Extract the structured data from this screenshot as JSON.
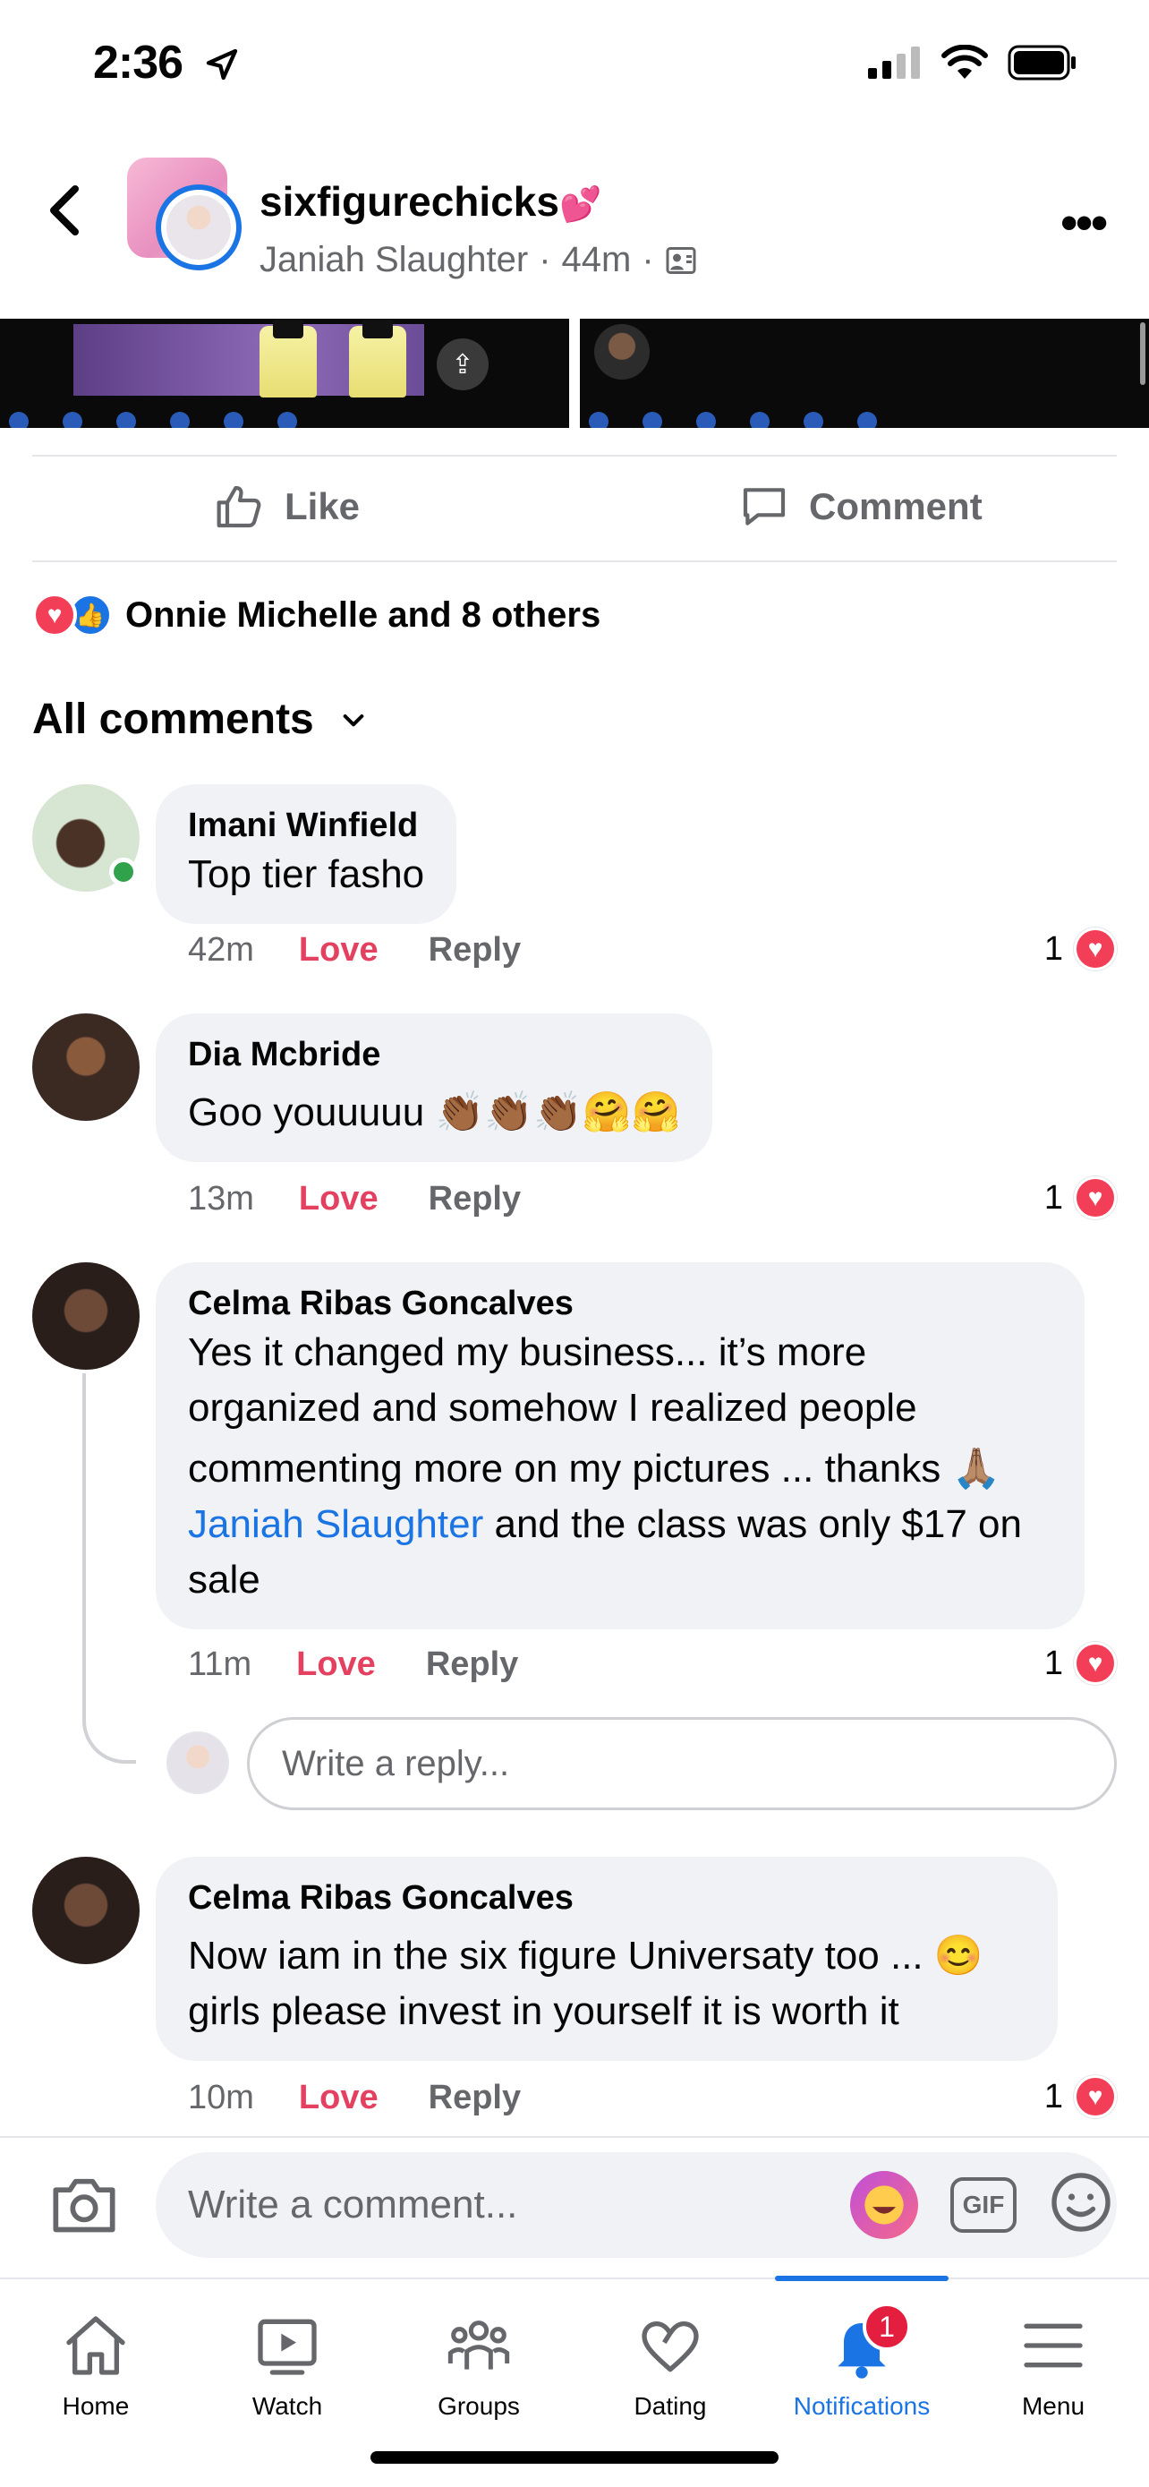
{
  "status_bar": {
    "time": "2:36"
  },
  "header": {
    "group_name": "sixfigurechicks",
    "group_name_emoji": "💕",
    "poster": "Janiah Slaughter",
    "separator": "·",
    "time_ago": "44m"
  },
  "actions": {
    "like_label": "Like",
    "comment_label": "Comment"
  },
  "reactions": {
    "summary": "Onnie Michelle and 8 others"
  },
  "comments_filter": {
    "label": "All comments"
  },
  "comments": [
    {
      "name": "Imani Winfield",
      "text": "Top tier fasho",
      "time": "42m",
      "love_label": "Love",
      "reply_label": "Reply",
      "reaction_count": "1",
      "avatar_color": "#d7e6d2"
    },
    {
      "name": "Dia Mcbride",
      "text": "Goo youuuuu 👏🏾👏🏾👏🏾🤗🤗",
      "time": "13m",
      "love_label": "Love",
      "reply_label": "Reply",
      "reaction_count": "1",
      "avatar_color": "#3b2a22"
    },
    {
      "name": "Celma Ribas Goncalves",
      "text_lines": [
        "Yes it changed my business... it’s more",
        "organized and somehow I realized people",
        "commenting more on my pictures ... thanks 🙏🏽"
      ],
      "mention": "Janiah Slaughter",
      "text_after_mention": " and the class was only $17 on",
      "text_last_line": "sale",
      "time": "11m",
      "love_label": "Love",
      "reply_label": "Reply",
      "reaction_count": "1",
      "avatar_color": "#2a1e1a"
    },
    {
      "name": "Celma Ribas Goncalves",
      "text_lines": [
        "Now iam in the six figure Universaty too ... 😊",
        "girls please invest in yourself it is worth it"
      ],
      "time": "10m",
      "love_label": "Love",
      "reply_label": "Reply",
      "reaction_count": "1",
      "avatar_color": "#2a1e1a"
    }
  ],
  "reply_box": {
    "placeholder": "Write a reply..."
  },
  "composer": {
    "placeholder": "Write a comment...",
    "gif_label": "GIF"
  },
  "tabs": [
    {
      "label": "Home",
      "icon": "home-icon"
    },
    {
      "label": "Watch",
      "icon": "watch-icon"
    },
    {
      "label": "Groups",
      "icon": "groups-icon"
    },
    {
      "label": "Dating",
      "icon": "dating-icon"
    },
    {
      "label": "Notifications",
      "icon": "bell-icon",
      "badge": "1",
      "active": true
    },
    {
      "label": "Menu",
      "icon": "menu-icon"
    }
  ],
  "colors": {
    "accent": "#1b74e4",
    "love": "#e4405f",
    "secondary_text": "#65676b",
    "bubble": "#f0f2f5"
  }
}
